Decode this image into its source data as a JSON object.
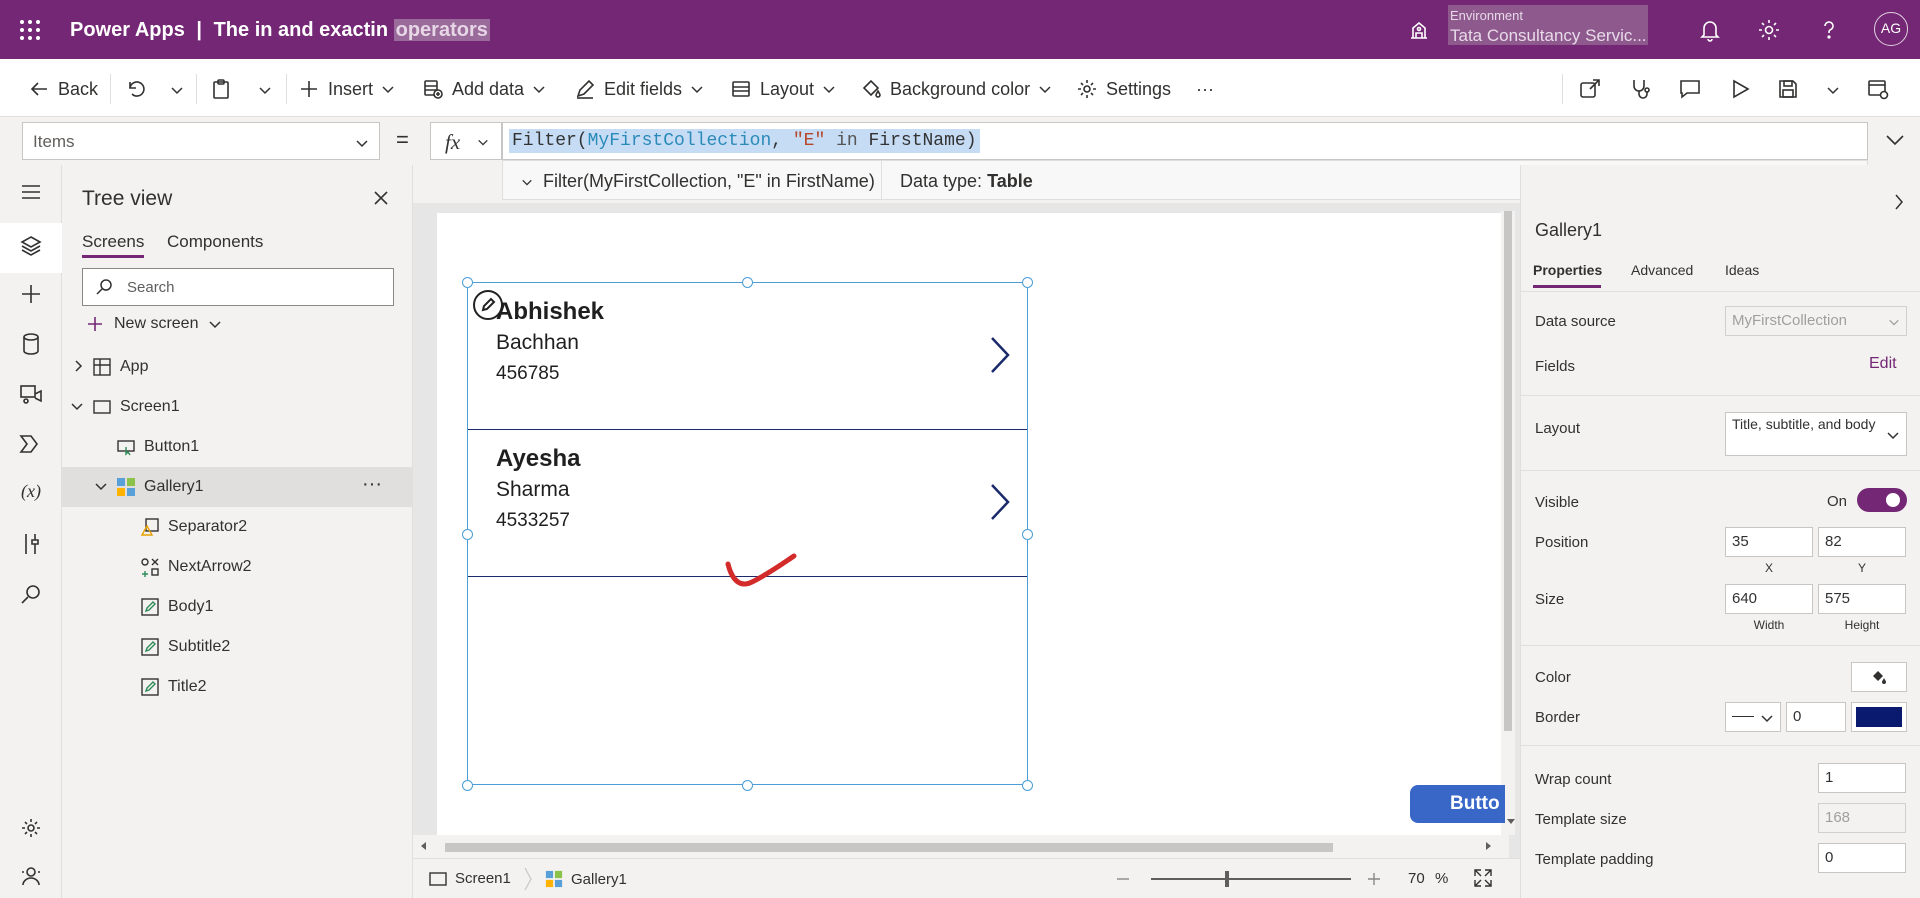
{
  "topbar": {
    "app_name": "Power Apps",
    "separator": "|",
    "doc_title": "The in and exactin",
    "doc_title_sel": "operators",
    "env_label": "Environment",
    "env_value": "Tata Consultancy Servic...",
    "avatar": "AG"
  },
  "commands": {
    "back": "Back",
    "insert": "Insert",
    "add_data": "Add data",
    "edit_fields": "Edit fields",
    "layout": "Layout",
    "background_color": "Background color",
    "settings": "Settings",
    "more": "···"
  },
  "formula_bar": {
    "property": "Items",
    "equals": "=",
    "fx": "fx",
    "formula_fn": "Filter(",
    "formula_id": "MyFirstCollection",
    "formula_sep": ", ",
    "formula_str": "\"E\"",
    "formula_kw": " in ",
    "formula_field": "FirstName",
    "formula_close": ")",
    "hint_expr": "Filter(MyFirstCollection, \"E\" in FirstName)",
    "data_type_label": "Data type:",
    "data_type_value": "Table"
  },
  "tree": {
    "title": "Tree view",
    "tabs": [
      "Screens",
      "Components"
    ],
    "search_placeholder": "Search",
    "new_screen": "New screen",
    "nodes": [
      "App",
      "Screen1",
      "Button1",
      "Gallery1",
      "Separator2",
      "NextArrow2",
      "Body1",
      "Subtitle2",
      "Title2"
    ],
    "more": "···"
  },
  "gallery": {
    "rows": [
      {
        "title": "Abhishek",
        "subtitle": "Bachhan",
        "body": "456785"
      },
      {
        "title": "Ayesha",
        "subtitle": "Sharma",
        "body": "4533257"
      }
    ],
    "button_label": "Butto"
  },
  "statusbar": {
    "screen": "Screen1",
    "gallery": "Gallery1",
    "zoom": "70",
    "zoom_unit": "%"
  },
  "props": {
    "control_name": "Gallery1",
    "tabs": [
      "Properties",
      "Advanced",
      "Ideas"
    ],
    "data_source_label": "Data source",
    "data_source_value": "MyFirstCollection",
    "fields_label": "Fields",
    "fields_edit": "Edit",
    "layout_label": "Layout",
    "layout_value": "Title, subtitle, and body",
    "visible_label": "Visible",
    "visible_value": "On",
    "position_label": "Position",
    "pos_x": "35",
    "pos_y": "82",
    "x_label": "X",
    "y_label": "Y",
    "size_label": "Size",
    "width": "640",
    "height": "575",
    "width_label": "Width",
    "height_label": "Height",
    "color_label": "Color",
    "border_label": "Border",
    "border_value": "0",
    "border_color": "#0a1a6e",
    "wrap_count_label": "Wrap count",
    "wrap_count": "1",
    "template_size_label": "Template size",
    "template_size": "168",
    "template_padding_label": "Template padding",
    "template_padding": "0"
  },
  "colors": {
    "brand": "#742774",
    "selection_handle": "#4a9dd6",
    "button": "#3867c8",
    "annotation": "#d32a2a"
  }
}
